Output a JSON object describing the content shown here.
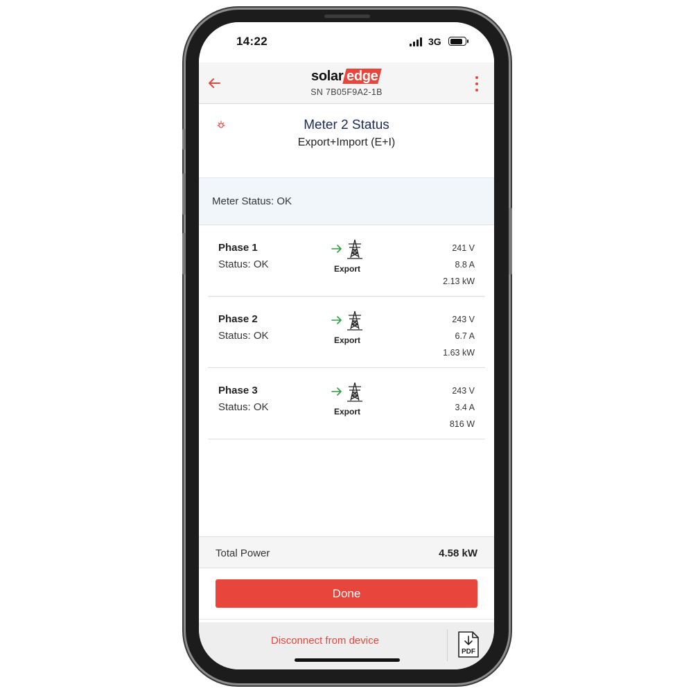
{
  "status_bar": {
    "time": "14:22",
    "network": "3G",
    "signal_bars": 4,
    "battery_level": 0.85
  },
  "header": {
    "brand": {
      "part1": "solar",
      "part2": "edge"
    },
    "serial": "SN 7B05F9A2-1B",
    "back_icon": "arrow-left-icon",
    "menu_icon": "kebab-menu-icon"
  },
  "title": {
    "main": "Meter 2 Status",
    "sub": "Export+Import (E+I)",
    "icon": "meter-sun-icon"
  },
  "meter_status": "Meter Status: OK",
  "phases": [
    {
      "name": "Phase 1",
      "status": "Status: OK",
      "flow": "Export",
      "voltage": "241 V",
      "current": "8.8 A",
      "power": "2.13 kW"
    },
    {
      "name": "Phase 2",
      "status": "Status: OK",
      "flow": "Export",
      "voltage": "243 V",
      "current": "6.7 A",
      "power": "1.63 kW"
    },
    {
      "name": "Phase 3",
      "status": "Status: OK",
      "flow": "Export",
      "voltage": "243 V",
      "current": "3.4 A",
      "power": "816 W"
    }
  ],
  "total": {
    "label": "Total Power",
    "value": "4.58 kW"
  },
  "done_label": "Done",
  "footer": {
    "disconnect_label": "Disconnect from device",
    "pdf_label": "PDF"
  },
  "colors": {
    "accent": "#e8453c",
    "title": "#1b2a5a",
    "export_arrow": "#2e9b3f"
  }
}
